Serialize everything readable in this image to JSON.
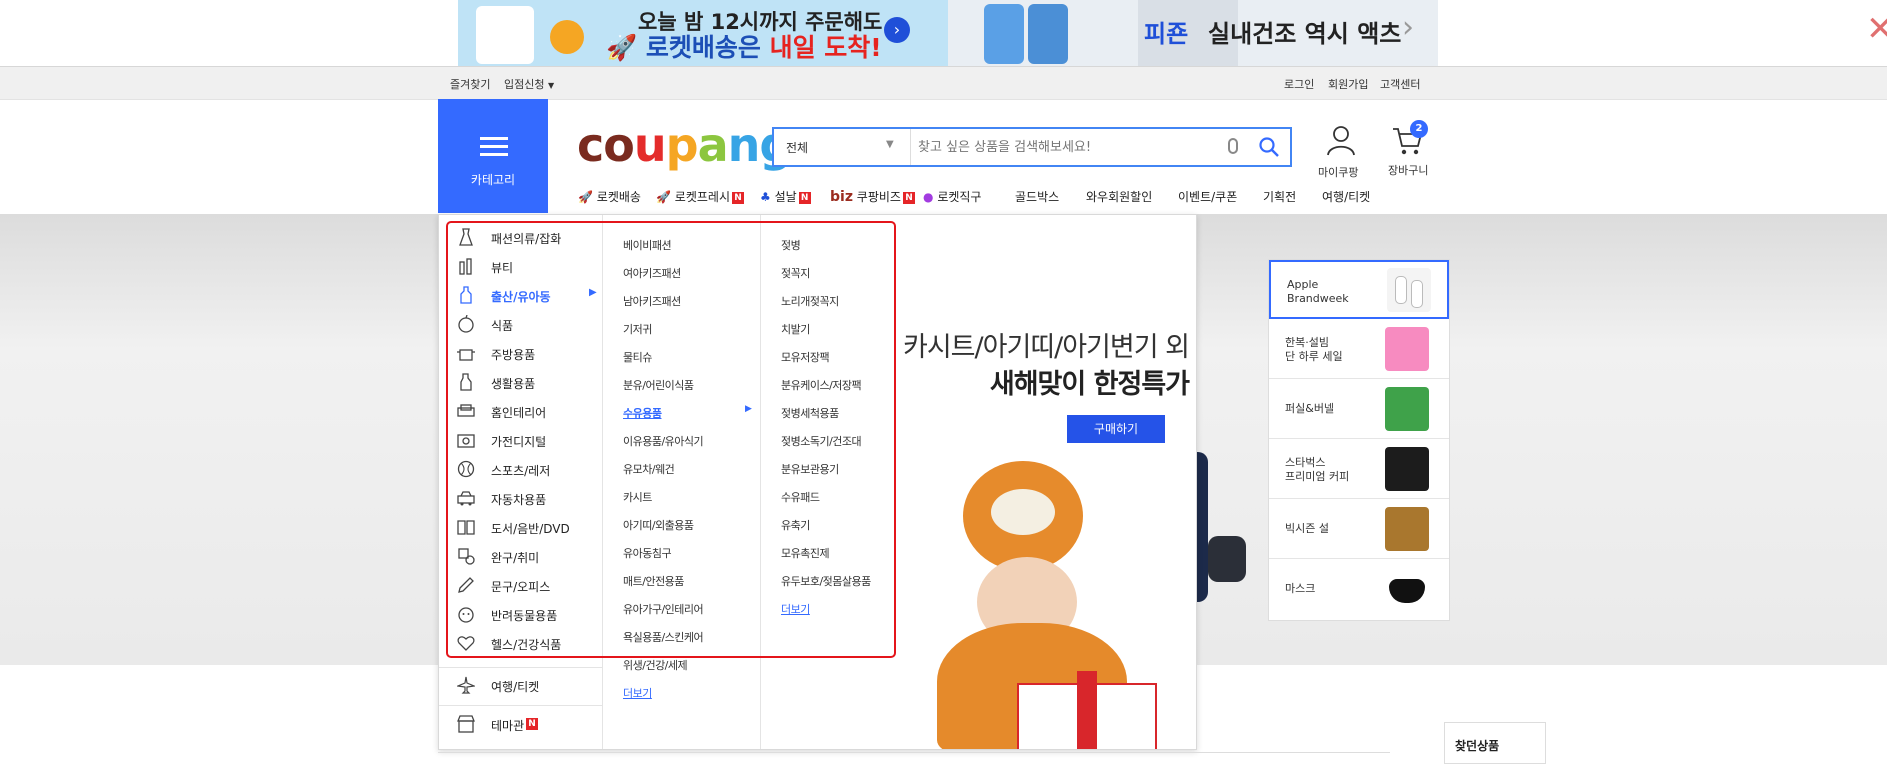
{
  "banner": {
    "left_line1": "오늘 밤 12시까지 주문해도",
    "left_line2_prefix": "로켓배송은",
    "left_line2_highlight": "내일 도착!",
    "right_brand": "피죤",
    "right_text": "실내건조 역시 액츠",
    "brand_color": "#346aff"
  },
  "utility": {
    "favorites": "즐겨찾기",
    "seller": "입점신청",
    "login": "로그인",
    "signup": "회원가입",
    "support": "고객센터"
  },
  "header": {
    "category_label": "카테고리",
    "logo": "coupang",
    "search_scope": "전체",
    "search_placeholder": "찾고 싶은 상품을 검색해보세요!",
    "mycoupang": "마이쿠팡",
    "cart": "장바구니",
    "cart_count": "2"
  },
  "nav": [
    {
      "label": "로켓배송",
      "badge": ""
    },
    {
      "label": "로켓프레시",
      "badge": "N"
    },
    {
      "label": "설날",
      "badge": "N"
    },
    {
      "label": "쿠팡비즈",
      "prefix": "biz",
      "badge": "N"
    },
    {
      "label": "로켓직구",
      "badge": ""
    },
    {
      "label": "골드박스",
      "badge": ""
    },
    {
      "label": "와우회원할인",
      "badge": ""
    },
    {
      "label": "이벤트/쿠폰",
      "badge": ""
    },
    {
      "label": "기획전",
      "badge": ""
    },
    {
      "label": "여행/티켓",
      "badge": ""
    }
  ],
  "categories": [
    "패션의류/잡화",
    "뷰티",
    "출산/유아동",
    "식품",
    "주방용품",
    "생활용품",
    "홈인테리어",
    "가전디지털",
    "스포츠/레저",
    "자동차용품",
    "도서/음반/DVD",
    "완구/취미",
    "문구/오피스",
    "반려동물용품",
    "헬스/건강식품"
  ],
  "categories_extra": {
    "travel": "여행/티켓",
    "theme": "테마관",
    "theme_badge": "N"
  },
  "sub_categories": [
    "베이비패션",
    "여아키즈패션",
    "남아키즈패션",
    "기저귀",
    "물티슈",
    "분유/어린이식품",
    "수유용품",
    "이유용품/유아식기",
    "유모차/웨건",
    "카시트",
    "아기띠/외출용품",
    "유아동침구",
    "매트/안전용품",
    "유아가구/인테리어",
    "욕실용품/스킨케어",
    "위생/건강/세제",
    "더보기"
  ],
  "sub_sub_categories": [
    "젖병",
    "젖꼭지",
    "노리개젖꼭지",
    "치발기",
    "모유저장팩",
    "분유케이스/저장팩",
    "젖병세척용품",
    "젖병소독기/건조대",
    "분유보관용기",
    "수유패드",
    "유축기",
    "모유촉진제",
    "유두보호/젖몸살용품",
    "더보기"
  ],
  "hero": {
    "line1": "카시트/아기띠/아기변기 외",
    "line2": "새해맞이 한정특가",
    "button": "구매하기"
  },
  "side_promos": [
    {
      "label": "Apple\nBrandweek"
    },
    {
      "label": "한복·설빔\n단 하루 세일"
    },
    {
      "label": "퍼실&버넬"
    },
    {
      "label": "스타벅스\n프리미엄 커피"
    },
    {
      "label": "빅시즌 설"
    },
    {
      "label": "마스크"
    }
  ],
  "recent": {
    "title": "찾던상품"
  }
}
